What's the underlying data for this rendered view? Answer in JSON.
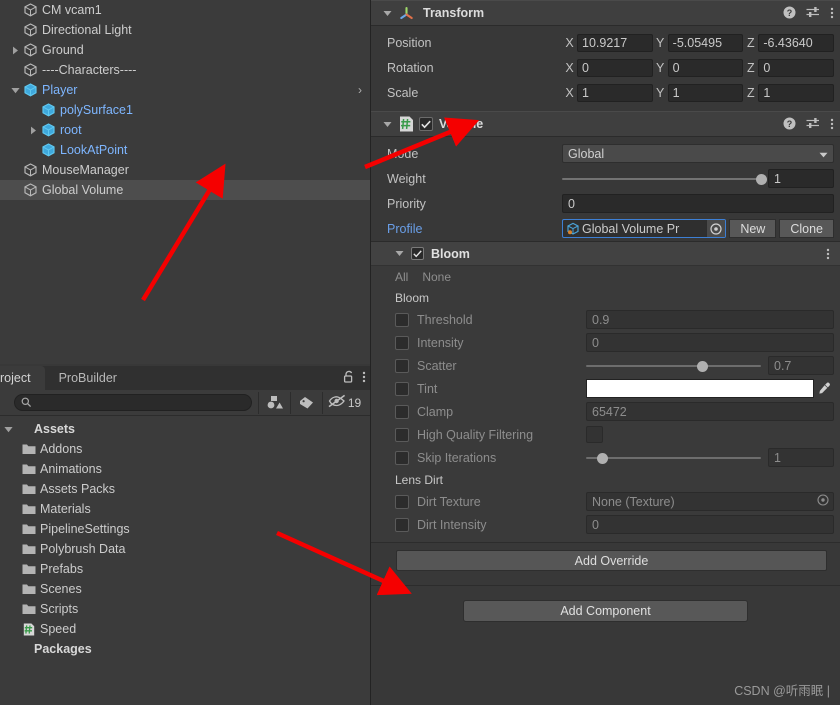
{
  "hierarchy": {
    "items": [
      {
        "label": "CM vcam1",
        "depth": 1,
        "twisty": "none",
        "icon": "cube-icon",
        "prefab": false,
        "selected": false
      },
      {
        "label": "Directional Light",
        "depth": 1,
        "twisty": "none",
        "icon": "cube-icon",
        "prefab": false,
        "selected": false
      },
      {
        "label": "Ground",
        "depth": 1,
        "twisty": "collapsed",
        "icon": "cube-icon",
        "prefab": false,
        "selected": false
      },
      {
        "label": "----Characters----",
        "depth": 1,
        "twisty": "none",
        "icon": "cube-icon",
        "prefab": false,
        "selected": false
      },
      {
        "label": "Player",
        "depth": 1,
        "twisty": "expanded",
        "icon": "prefab-cube-icon",
        "prefab": true,
        "selected": false,
        "overflow_arrow": ">"
      },
      {
        "label": "polySurface1",
        "depth": 2,
        "twisty": "none",
        "icon": "cube-icon",
        "prefab": true,
        "selected": false
      },
      {
        "label": "root",
        "depth": 2,
        "twisty": "collapsed",
        "icon": "cube-icon",
        "prefab": true,
        "selected": false
      },
      {
        "label": "LookAtPoint",
        "depth": 2,
        "twisty": "none",
        "icon": "cube-icon",
        "prefab": true,
        "selected": false
      },
      {
        "label": "MouseManager",
        "depth": 1,
        "twisty": "none",
        "icon": "cube-icon",
        "prefab": false,
        "selected": false
      },
      {
        "label": "Global Volume",
        "depth": 1,
        "twisty": "none",
        "icon": "cube-icon",
        "prefab": false,
        "selected": true
      }
    ]
  },
  "project": {
    "tabs": [
      {
        "label": "roject",
        "active": true
      },
      {
        "label": "ProBuilder",
        "active": false
      }
    ],
    "lock_icon": "lock-open-icon",
    "menu_icon": "kebab-menu-icon",
    "search": {
      "value": "",
      "placeholder": "",
      "icon": "search-icon"
    },
    "filters": [
      {
        "icon": "type-filter-icon",
        "label": ""
      },
      {
        "icon": "label-filter-icon",
        "label": ""
      },
      {
        "icon": "hidden-eye-icon",
        "label": "19"
      }
    ],
    "tree": [
      {
        "label": "Assets",
        "type": "root",
        "icon": "none",
        "twisty": "expanded"
      },
      {
        "label": "Addons",
        "type": "folder",
        "icon": "folder-icon"
      },
      {
        "label": "Animations",
        "type": "folder",
        "icon": "folder-icon"
      },
      {
        "label": "Assets Packs",
        "type": "folder",
        "icon": "folder-icon"
      },
      {
        "label": "Materials",
        "type": "folder",
        "icon": "folder-icon"
      },
      {
        "label": "PipelineSettings",
        "type": "folder",
        "icon": "folder-icon"
      },
      {
        "label": "Polybrush Data",
        "type": "folder",
        "icon": "folder-icon"
      },
      {
        "label": "Prefabs",
        "type": "folder",
        "icon": "folder-icon"
      },
      {
        "label": "Scenes",
        "type": "folder",
        "icon": "folder-icon"
      },
      {
        "label": "Scripts",
        "type": "folder",
        "icon": "folder-icon"
      },
      {
        "label": "Speed",
        "type": "script",
        "icon": "script-icon"
      },
      {
        "label": "Packages",
        "type": "root",
        "icon": "none",
        "twisty": "none"
      }
    ]
  },
  "inspector": {
    "transform": {
      "title": "Transform",
      "icon": "transform-gizmo-icon",
      "expanded": true,
      "help_icon": "help-icon",
      "preset_icon": "preset-settings-icon",
      "menu_icon": "kebab-menu-icon",
      "rows": [
        {
          "label": "Position",
          "x_axis": "X",
          "x": "10.9217",
          "y_axis": "Y",
          "y": "-5.05495",
          "z_axis": "Z",
          "z": "-6.43640"
        },
        {
          "label": "Rotation",
          "x_axis": "X",
          "x": "0",
          "y_axis": "Y",
          "y": "0",
          "z_axis": "Z",
          "z": "0"
        },
        {
          "label": "Scale",
          "x_axis": "X",
          "x": "1",
          "y_axis": "Y",
          "y": "1",
          "z_axis": "Z",
          "z": "1"
        }
      ]
    },
    "volume": {
      "title": "Volume",
      "icon": "script-icon",
      "enabled": true,
      "expanded": true,
      "help_icon": "help-icon",
      "preset_icon": "preset-settings-icon",
      "menu_icon": "kebab-menu-icon",
      "mode_label": "Mode",
      "mode_value": "Global",
      "weight_label": "Weight",
      "weight_value": "1",
      "weight_pct": 100,
      "priority_label": "Priority",
      "priority_value": "0",
      "profile_label": "Profile",
      "profile_value": "Global Volume Pr",
      "profile_icon": "volume-profile-icon",
      "profile_picker_icon": "object-picker-icon",
      "new_label": "New",
      "clone_label": "Clone"
    },
    "bloom": {
      "title": "Bloom",
      "enabled": true,
      "expanded": true,
      "menu_icon": "kebab-menu-icon",
      "all_label": "All",
      "none_label": "None",
      "group_label": "Bloom",
      "lens_dirt_label": "Lens Dirt",
      "overrides": [
        {
          "label": "Threshold",
          "checked": false,
          "control": "field",
          "value": "0.9"
        },
        {
          "label": "Intensity",
          "checked": false,
          "control": "field",
          "value": "0"
        },
        {
          "label": "Scatter",
          "checked": false,
          "control": "slider",
          "value": "0.7",
          "pct": 66
        },
        {
          "label": "Tint",
          "checked": false,
          "control": "color",
          "value": "#ffffff"
        },
        {
          "label": "Clamp",
          "checked": false,
          "control": "field",
          "value": "65472"
        },
        {
          "label": "High Quality Filtering",
          "checked": false,
          "control": "checkbox",
          "value": ""
        },
        {
          "label": "Skip Iterations",
          "checked": false,
          "control": "slider",
          "value": "1",
          "pct": 9
        }
      ],
      "lens_dirt_overrides": [
        {
          "label": "Dirt Texture",
          "checked": false,
          "control": "object",
          "value": "None (Texture)"
        },
        {
          "label": "Dirt Intensity",
          "checked": false,
          "control": "field",
          "value": "0"
        }
      ]
    },
    "add_override_label": "Add Override",
    "add_component_label": "Add Component"
  },
  "watermark": "CSDN @听雨眠 |",
  "colors": {
    "panel_bg": "#383838",
    "hierarchy_bg": "#3b3b3b",
    "header_bg": "#3f3f3f",
    "selection": "#4d4d4d",
    "prefab_blue": "#7eb6ff",
    "link_blue": "#6a9fe8",
    "accent_border": "#3d7fd4",
    "annotation_red": "#f50000"
  }
}
